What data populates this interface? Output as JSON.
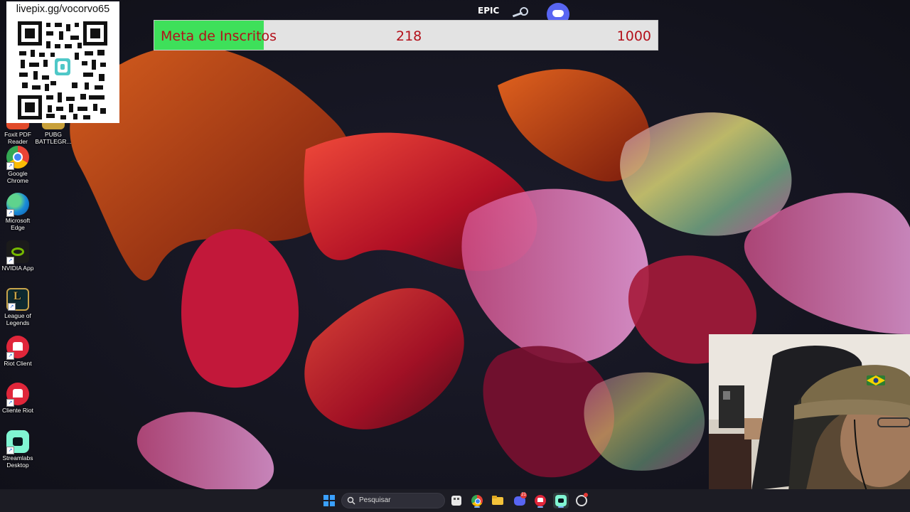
{
  "desktop": {
    "icons": [
      {
        "name": "foxit-pdf-reader",
        "label": "Foxit PDF Reader",
        "label_lines": [
          "Foxit PDF",
          "Reader"
        ]
      },
      {
        "name": "pubg-battlegrounds",
        "label": "PUBG BATTLEGR...",
        "label_lines": [
          "PUBG",
          "BATTLEGR..."
        ]
      },
      {
        "name": "google-chrome",
        "label": "Google Chrome",
        "label_lines": [
          "Google",
          "Chrome"
        ]
      },
      {
        "name": "microsoft-edge",
        "label": "Microsoft Edge",
        "label_lines": [
          "Microsoft",
          "Edge"
        ]
      },
      {
        "name": "nvidia-app",
        "label": "NVIDIA App",
        "label_lines": [
          "NVIDIA App"
        ]
      },
      {
        "name": "league-of-legends",
        "label": "League of Legends",
        "label_lines": [
          "League of",
          "Legends"
        ]
      },
      {
        "name": "riot-client",
        "label": "Riot Client",
        "label_lines": [
          "Riot Client"
        ]
      },
      {
        "name": "cliente-riot",
        "label": "Cliente Riot",
        "label_lines": [
          "Cliente Riot"
        ]
      },
      {
        "name": "streamlabs-desktop",
        "label": "Streamlabs Desktop",
        "label_lines": [
          "Streamlabs",
          "Desktop"
        ]
      }
    ]
  },
  "overlay": {
    "donation_url": "livepix.gg/vocorvo65",
    "goal": {
      "label": "Meta de Inscritos",
      "current": "218",
      "target": "1000",
      "progress_fraction": 0.218,
      "fill_color": "#3ee05a",
      "text_color": "#b3101a"
    },
    "top_icons": [
      "epic-games-icon",
      "steam-icon",
      "discord-icon"
    ],
    "epic_text": "EPIC"
  },
  "taskbar": {
    "search_placeholder": "Pesquisar",
    "apps": [
      "windows-start-icon",
      "search-icon",
      "widgets-icon",
      "chrome-icon",
      "file-explorer-icon",
      "discord-icon",
      "riot-client-icon",
      "streamlabs-icon",
      "obs-icon"
    ],
    "discord_badge": "21"
  }
}
